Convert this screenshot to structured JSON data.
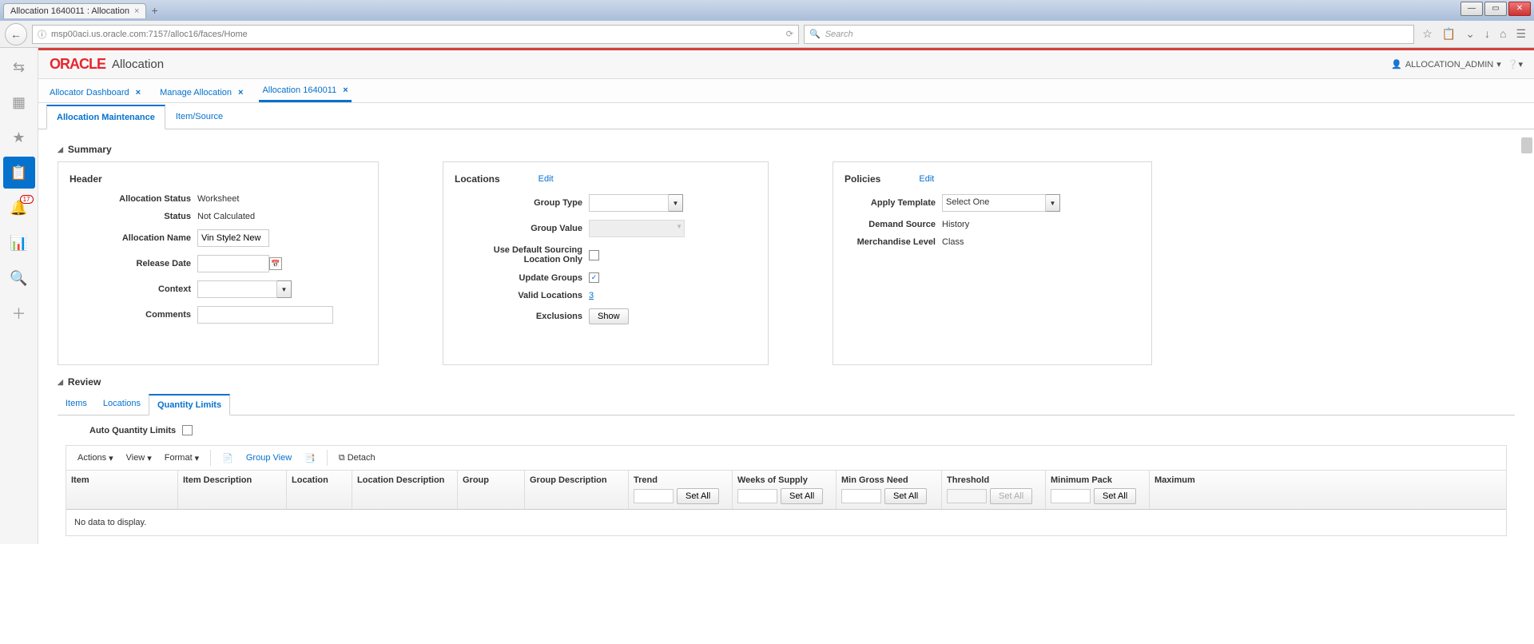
{
  "browser": {
    "tab_title": "Allocation 1640011 : Allocation",
    "url": "msp00aci.us.oracle.com:7157/alloc16/faces/Home",
    "search_placeholder": "Search"
  },
  "left_rail": {
    "badge": "17"
  },
  "app_header": {
    "logo": "ORACLE",
    "title": "Allocation",
    "user": "ALLOCATION_ADMIN"
  },
  "main_tabs": [
    {
      "label": "Allocator Dashboard"
    },
    {
      "label": "Manage Allocation"
    },
    {
      "label": "Allocation 1640011"
    }
  ],
  "sub_tabs": [
    {
      "label": "Allocation Maintenance"
    },
    {
      "label": "Item/Source"
    }
  ],
  "summary": {
    "title": "Summary"
  },
  "header_panel": {
    "title": "Header",
    "allocation_status_label": "Allocation Status",
    "allocation_status_value": "Worksheet",
    "status_label": "Status",
    "status_value": "Not Calculated",
    "allocation_name_label": "Allocation Name",
    "allocation_name_value": "Vin Style2 New",
    "release_date_label": "Release Date",
    "context_label": "Context",
    "comments_label": "Comments"
  },
  "locations_panel": {
    "title": "Locations",
    "edit": "Edit",
    "group_type_label": "Group Type",
    "group_value_label": "Group Value",
    "default_sourcing_label": "Use Default Sourcing Location Only",
    "update_groups_label": "Update Groups",
    "valid_locations_label": "Valid Locations",
    "valid_locations_value": "3",
    "exclusions_label": "Exclusions",
    "show_btn": "Show"
  },
  "policies_panel": {
    "title": "Policies",
    "edit": "Edit",
    "apply_template_label": "Apply Template",
    "apply_template_value": "Select One",
    "demand_source_label": "Demand Source",
    "demand_source_value": "History",
    "merch_level_label": "Merchandise Level",
    "merch_level_value": "Class"
  },
  "review": {
    "title": "Review",
    "tabs": [
      {
        "label": "Items"
      },
      {
        "label": "Locations"
      },
      {
        "label": "Quantity Limits"
      }
    ],
    "auto_qty_label": "Auto Quantity Limits"
  },
  "toolbar": {
    "actions": "Actions",
    "view": "View",
    "format": "Format",
    "group_view": "Group View",
    "detach": "Detach"
  },
  "grid": {
    "columns": [
      "Item",
      "Item Description",
      "Location",
      "Location Description",
      "Group",
      "Group Description",
      "Trend",
      "Weeks of Supply",
      "Min Gross Need",
      "Threshold",
      "Minimum Pack",
      "Maximum"
    ],
    "set_all": "Set All",
    "no_data": "No data to display."
  }
}
